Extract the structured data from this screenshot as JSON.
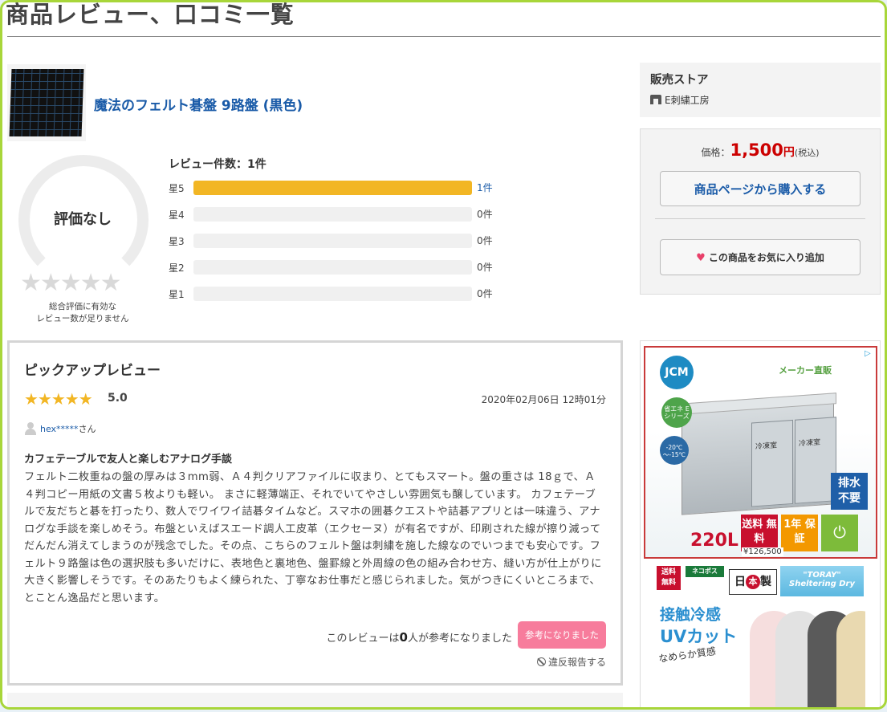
{
  "page": {
    "title": "商品レビュー、口コミ一覧"
  },
  "product": {
    "name": "魔法のフェルト碁盤 9路盤 (黒色)"
  },
  "rating_summary": {
    "no_rating": "評価なし",
    "insufficient_note_line1": "総合評価に有効な",
    "insufficient_note_line2": "レビュー数が足りません",
    "review_count_label": "レビュー件数：1件",
    "histogram": [
      {
        "label": "星5",
        "count": "1件",
        "fraction": 1.0
      },
      {
        "label": "星4",
        "count": "0件",
        "fraction": 0
      },
      {
        "label": "星3",
        "count": "0件",
        "fraction": 0
      },
      {
        "label": "星2",
        "count": "0件",
        "fraction": 0
      },
      {
        "label": "星1",
        "count": "0件",
        "fraction": 0
      }
    ]
  },
  "pickup_review": {
    "section_title": "ピックアップレビュー",
    "stars": "★★★★★",
    "score": "5.0",
    "date": "2020年02月06日 12時01分",
    "user": "hex*****",
    "user_suffix": "さん",
    "heading": "カフェテーブルで友人と楽しむアナログ手談",
    "body": "フェルト二枚重ねの盤の厚みは３mm弱、Ａ４判クリアファイルに収まり、とてもスマート。盤の重さは 18ｇで、Ａ４判コピー用紙の文書５枚よりも軽い。 まさに軽薄端正、それでいてやさしい雰囲気も醸しています。 カフェテーブルで友だちと碁を打ったり、数人でワイワイ詰碁タイムなど。スマホの囲碁クエストや詰碁アプリとは一味違う、アナログな手談を楽しめそう。布盤といえばスエード調人工皮革（エクセーヌ）が有名ですが、印刷された線が擦り減ってだんだん消えてしまうのが残念でした。その点、こちらのフェルト盤は刺繍を施した線なのでいつまでも安心です。フェルト９路盤は色の選択肢も多いだけに、表地色と裏地色、盤罫線と外周線の色の組み合わせ方、縫い方が仕上がりに大きく影響しそうです。そのあたりもよく練られた、丁寧なお仕事だと感じられました。気がつきにくいところまで、とことん逸品だと思います。",
    "helpful_prefix": "このレビューは",
    "helpful_count": "0",
    "helpful_suffix": "人が参考になりました",
    "helpful_button": "参考になりました",
    "report": "違反報告する"
  },
  "store": {
    "title": "販売ストア",
    "name": "E刺繍工房"
  },
  "price": {
    "label": "価格：",
    "amount": "1,500",
    "yen": "円",
    "tax": "(税込)",
    "buy_button": "商品ページから購入する",
    "favorite_button": "この商品をお気に入り追加"
  },
  "ads": {
    "ad1": {
      "brand": "JCM",
      "maker_direct": "メーカー直販",
      "eco": "省エネ Eシリーズ",
      "temp": "-20℃ ～-15℃",
      "door_label": "冷凍室",
      "drain": "排水 不要",
      "shipping": "送料 無料",
      "warranty": "1年 保証",
      "capacity": "220L",
      "price": "¥126,500"
    },
    "ad2": {
      "shipping": "送料 無料",
      "nekopos": "ネコポス",
      "japan_pre": "日",
      "japan_mid": "本",
      "japan_post": "製",
      "toray": "\"TORAY\" Sheltering Dry",
      "contact_cool": "接触冷感",
      "uv_cut": "UVカット",
      "smooth": "なめらか質感"
    }
  },
  "colors": {
    "accent_bar": "#f2b624",
    "link": "#1a5ba8",
    "price": "#cc0000",
    "helpful_button": "#f77c9c",
    "frame": "#a8d63a"
  }
}
